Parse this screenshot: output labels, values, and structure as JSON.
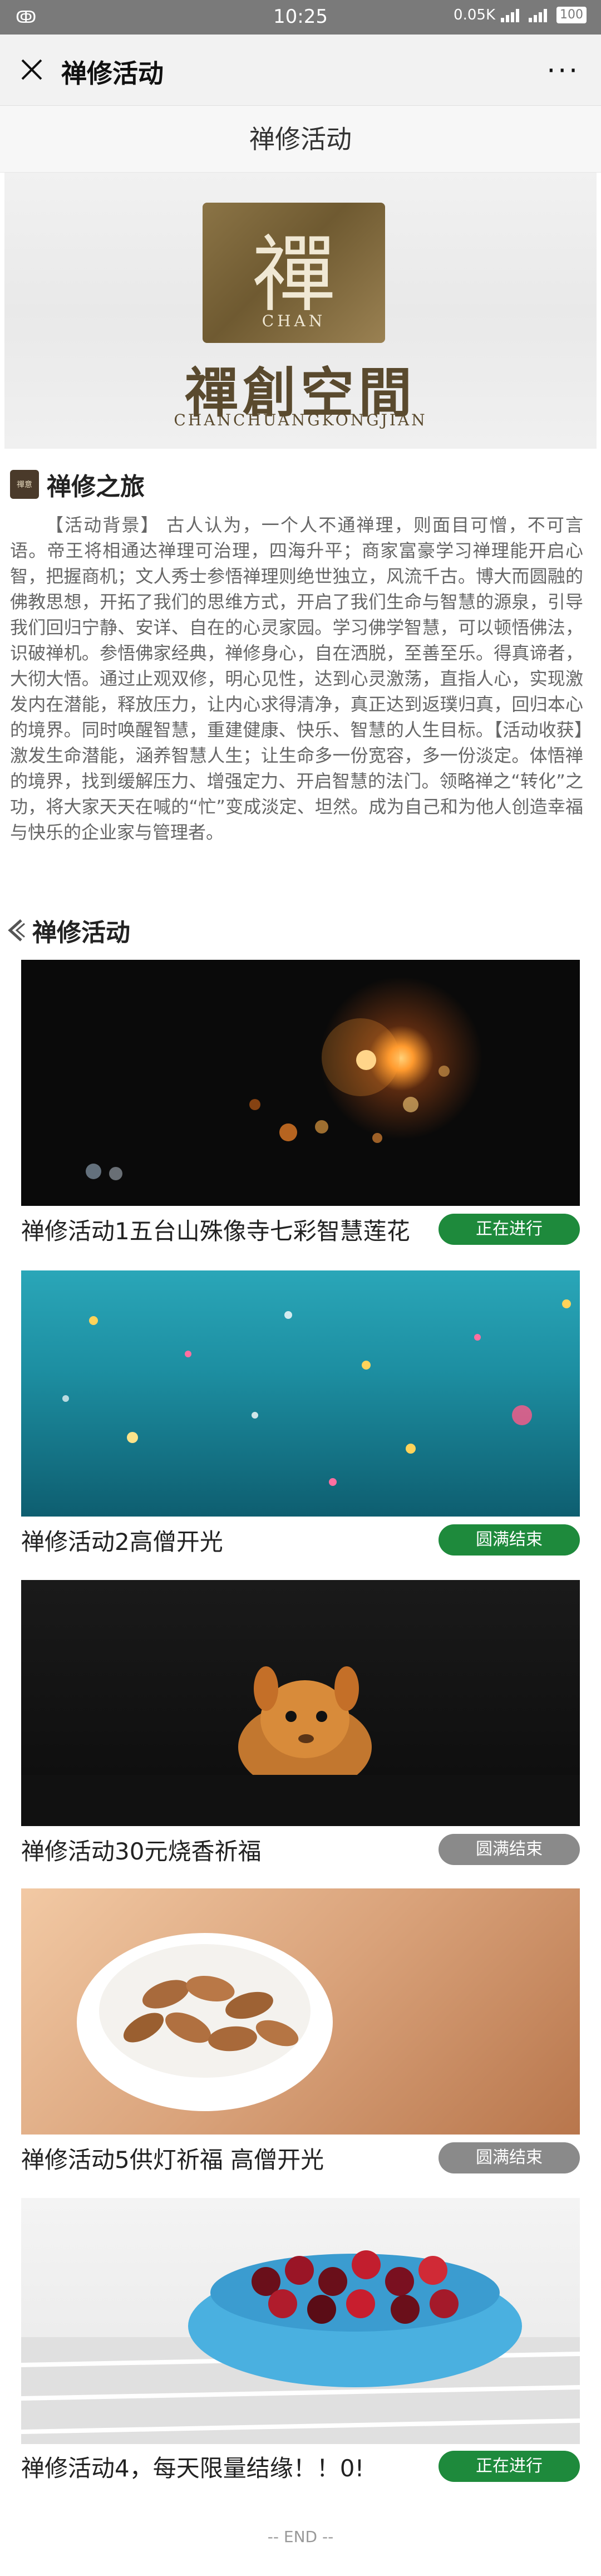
{
  "statusbar": {
    "left": "ↂ",
    "time": "10:25",
    "net": "0.05K",
    "battery": "100"
  },
  "titlebar": {
    "title": "禅修活动",
    "more": "···"
  },
  "page": {
    "header": "禅修活动"
  },
  "banner": {
    "seal_char": "禪",
    "seal_sub": "CHAN",
    "brand": "禪創空間",
    "brand_sub": "CHANCHUANGKONGJIAN"
  },
  "intro": {
    "badge": "禪意",
    "title": "禅修之旅",
    "text": "【活动背景】 古人认为，一个人不通禅理，则面目可憎，不可言语。帝王将相通达禅理可治理，四海升平；商家富豪学习禅理能开启心智，把握商机；文人秀士参悟禅理则绝世独立，风流千古。博大而圆融的佛教思想，开拓了我们的思维方式，开启了我们生命与智慧的源泉，引导我们回归宁静、安详、自在的心灵家园。学习佛学智慧，可以顿悟佛法，识破禅机。参悟佛家经典，禅修身心，自在洒脱，至善至乐。得真谛者，大彻大悟。通过止观双修，明心见性，达到心灵激荡，直指人心，实现激发内在潜能，释放压力，让内心求得清净，真正达到返璞归真，回归本心的境界。同时唤醒智慧，重建健康、快乐、智慧的人生目标。【活动收获】激发生命潜能，涵养智慧人生；让生命多一份宽容，多一份淡定。体悟禅的境界，找到缓解压力、增强定力、开启智慧的法门。领略禅之“转化”之功，将大家天天在喊的“忙”变成淡定、坦然。成为自己和为他人创造幸福与快乐的企业家与管理者。"
  },
  "activities": {
    "title": "禅修活动",
    "items": [
      {
        "title": "禅修活动1五台山殊像寺七彩智慧莲花",
        "status": "正在进行",
        "color": "#1e8a3c"
      },
      {
        "title": "禅修活动2高僧开光",
        "status": "圆满结束",
        "color": "#1e8a3c"
      },
      {
        "title": "禅修活动30元烧香祈福",
        "status": "圆满结束",
        "color": "#8a8a8a"
      },
      {
        "title": "禅修活动5供灯祈福 高僧开光",
        "status": "圆满结束",
        "color": "#8a8a8a"
      },
      {
        "title": "禅修活动4，每天限量结缘！！0!",
        "status": "正在进行",
        "color": "#1e8a3c"
      }
    ]
  },
  "footer": {
    "end": "-- END --"
  }
}
